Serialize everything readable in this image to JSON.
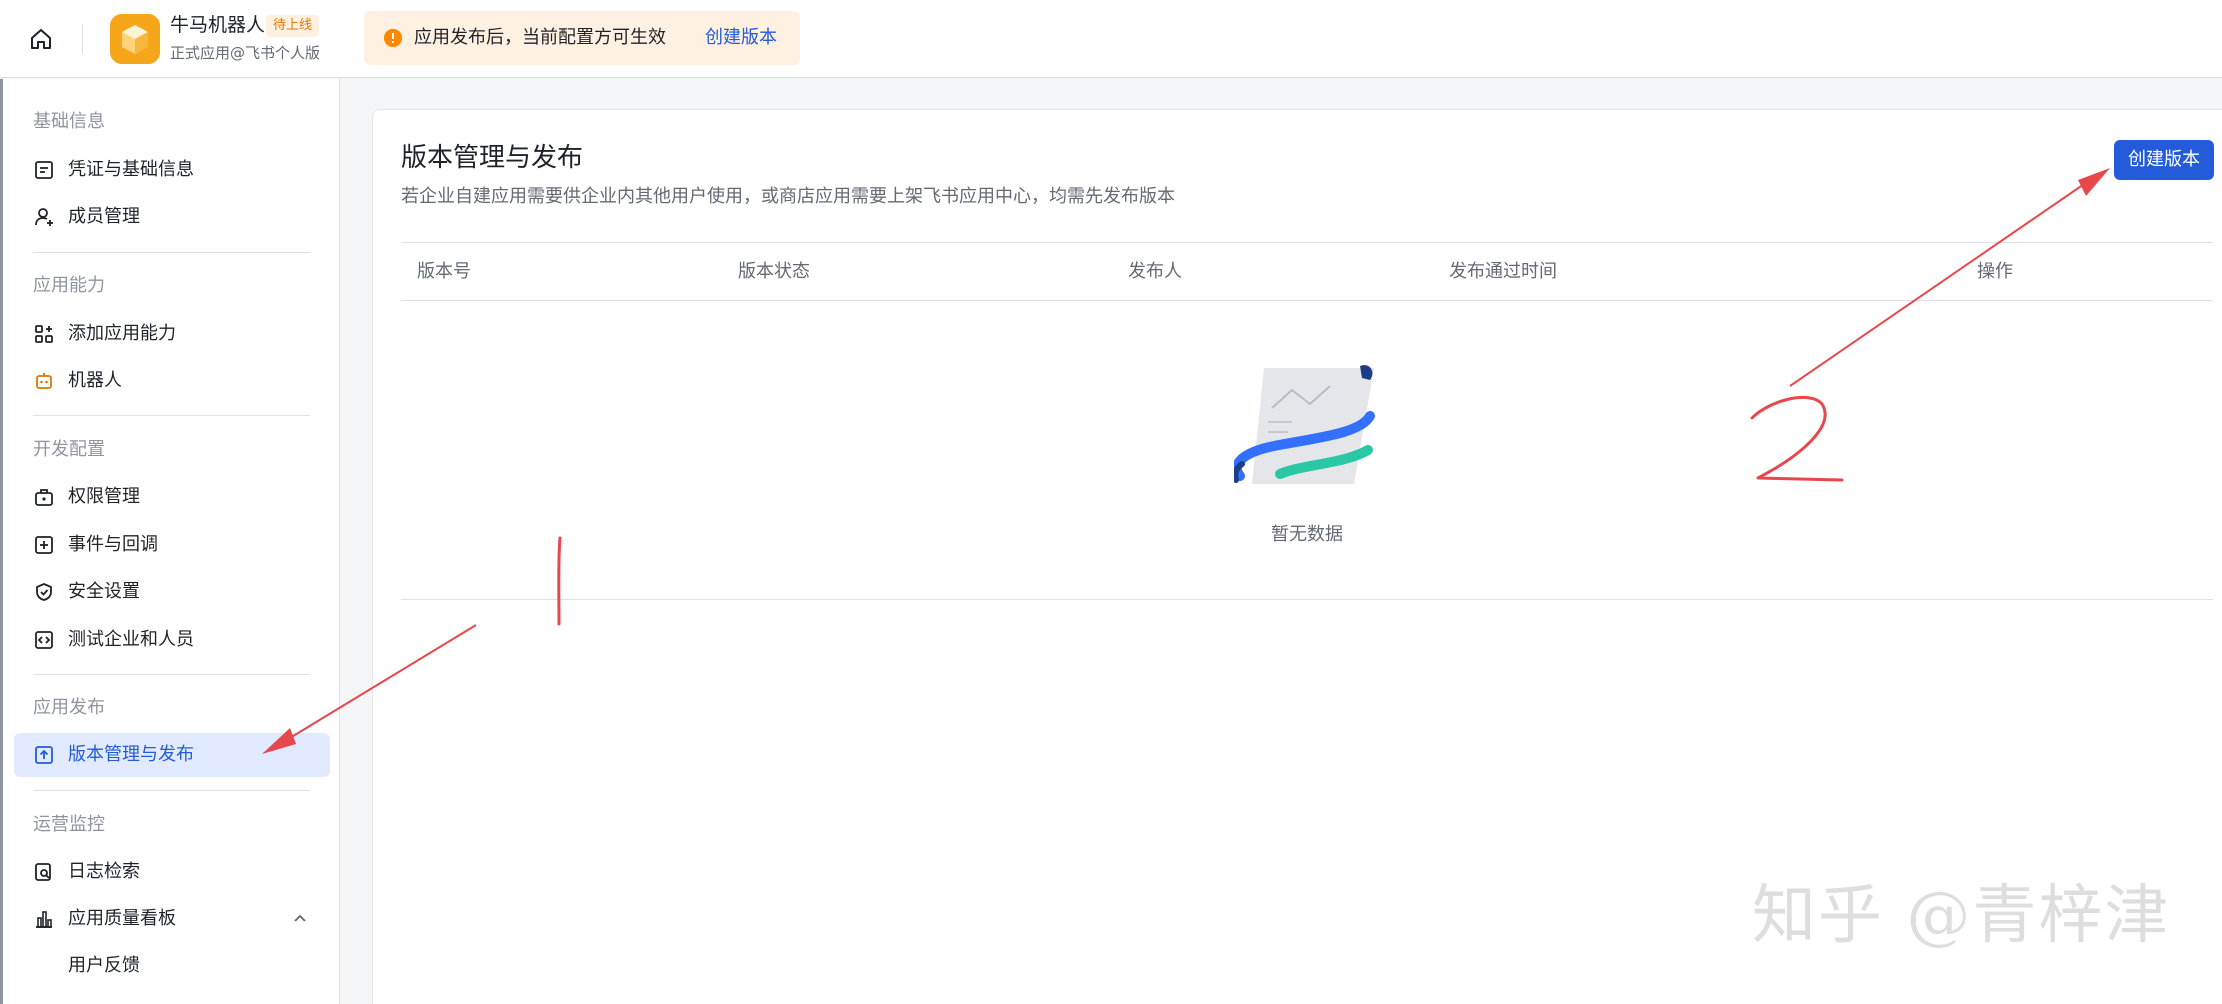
{
  "header": {
    "app_name": "牛马机器人",
    "app_badge": "待上线",
    "app_subtitle": "正式应用@飞书个人版",
    "notice_text": "应用发布后，当前配置方可生效",
    "notice_link": "创建版本"
  },
  "sidebar": {
    "sections": [
      {
        "title": "基础信息",
        "items": [
          {
            "label": "凭证与基础信息",
            "icon": "credential-icon"
          },
          {
            "label": "成员管理",
            "icon": "member-icon"
          }
        ]
      },
      {
        "title": "应用能力",
        "items": [
          {
            "label": "添加应用能力",
            "icon": "add-capability-icon"
          },
          {
            "label": "机器人",
            "icon": "robot-icon"
          }
        ]
      },
      {
        "title": "开发配置",
        "items": [
          {
            "label": "权限管理",
            "icon": "permission-icon"
          },
          {
            "label": "事件与回调",
            "icon": "event-icon"
          },
          {
            "label": "安全设置",
            "icon": "shield-icon"
          },
          {
            "label": "测试企业和人员",
            "icon": "code-icon"
          }
        ]
      },
      {
        "title": "应用发布",
        "items": [
          {
            "label": "版本管理与发布",
            "icon": "upload-icon",
            "active": true
          }
        ]
      },
      {
        "title": "运营监控",
        "items": [
          {
            "label": "日志检索",
            "icon": "log-search-icon"
          },
          {
            "label": "应用质量看板",
            "icon": "chart-icon"
          },
          {
            "label": "用户反馈",
            "icon": ""
          }
        ]
      }
    ]
  },
  "main": {
    "title": "版本管理与发布",
    "description": "若企业自建应用需要供企业内其他用户使用，或商店应用需要上架飞书应用中心，均需先发布版本",
    "create_button": "创建版本",
    "columns": [
      "版本号",
      "版本状态",
      "发布人",
      "发布通过时间",
      "操作"
    ],
    "empty_text": "暂无数据"
  },
  "annotations": {
    "mark_1": "1",
    "mark_2": "2",
    "color": "#e8474b"
  },
  "watermark": "知乎 @青梓津",
  "colors": {
    "accent": "#245bdb",
    "badge": "#de7802",
    "notice_bg": "#fef1e1"
  }
}
